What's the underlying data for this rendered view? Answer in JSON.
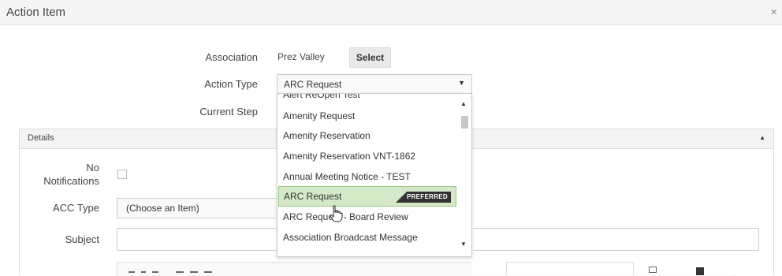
{
  "dialog": {
    "title": "Action Item",
    "close_glyph": "×"
  },
  "form": {
    "association": {
      "label": "Association",
      "value": "Prez Valley",
      "button": "Select"
    },
    "action_type": {
      "label": "Action Type",
      "selected": "ARC Request"
    },
    "current_step": {
      "label": "Current Step"
    }
  },
  "details": {
    "header": "Details",
    "no_notifications": {
      "label_line1": "No",
      "label_line2": "Notifications",
      "checked": false
    },
    "acc_type": {
      "label": "ACC Type",
      "value": "(Choose an Item)"
    },
    "subject": {
      "label": "Subject",
      "value": ""
    }
  },
  "dropdown": {
    "options": [
      {
        "label": "Alert ReOpen Test"
      },
      {
        "label": "Amenity Request"
      },
      {
        "label": "Amenity Reservation"
      },
      {
        "label": "Amenity Reservation VNT-1862"
      },
      {
        "label": "Annual Meeting Notice - TEST"
      },
      {
        "label": "ARC Request",
        "selected": true,
        "badge": "PREFERRED"
      },
      {
        "label": "ARC Request - Board Review"
      },
      {
        "label": "Association Broadcast Message"
      }
    ]
  },
  "colors": {
    "selected_bg": "#d3e9c8",
    "selected_border": "#9cc588",
    "badge_bg": "#333333"
  },
  "icons": {
    "close": "close-icon",
    "caret": "caret-down-icon",
    "collapse": "caret-up-icon",
    "cursor": "hand-pointer-icon"
  }
}
